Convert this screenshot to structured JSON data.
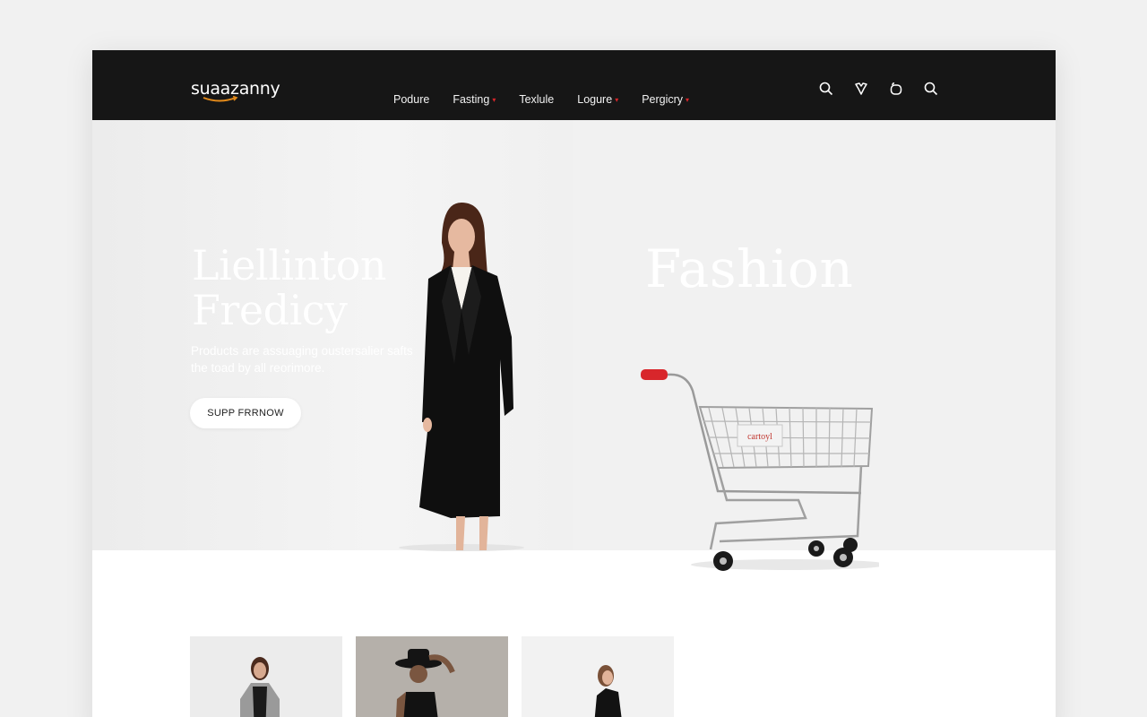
{
  "brand": {
    "name": "suaazanny",
    "accent_color": "#e38a1a"
  },
  "nav": {
    "items": [
      {
        "label": "Podure",
        "has_dropdown": false
      },
      {
        "label": "Fasting",
        "has_dropdown": true
      },
      {
        "label": "Texlule",
        "has_dropdown": false
      },
      {
        "label": "Logure",
        "has_dropdown": true
      },
      {
        "label": "Pergicry",
        "has_dropdown": true
      }
    ]
  },
  "header_icons": [
    "search-icon",
    "heart-icon",
    "bag-icon",
    "search-icon"
  ],
  "hero": {
    "title_line1": "Liellinton",
    "title_line2": "Fredicy",
    "subtitle": "Products are assuaging oustersalier safts the toad by all reorimore.",
    "cta_label": "SUPP FRRNOW",
    "right_title": "Fashion",
    "cart_tag": "cartoyl"
  },
  "colors": {
    "header_bg": "#161616",
    "cart_handle": "#d8262b",
    "caret": "#d8262b"
  },
  "thumbnails": [
    "product-thumb-1",
    "product-thumb-2",
    "product-thumb-3"
  ]
}
